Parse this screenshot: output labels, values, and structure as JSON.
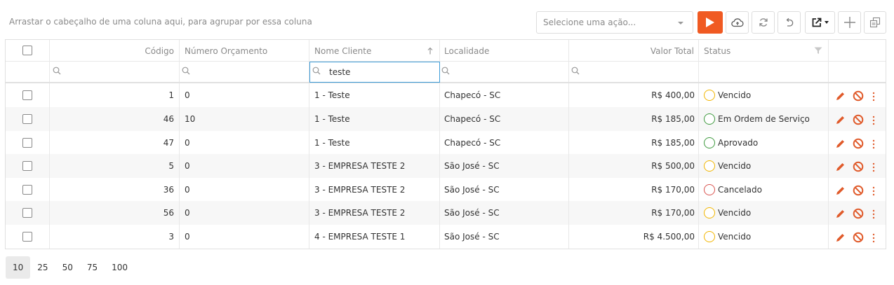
{
  "toolbar": {
    "group_panel_text": "Arrastar o cabeçalho de uma coluna aqui, para agrupar por essa coluna",
    "action_select_placeholder": "Selecione uma ação...",
    "buttons": [
      "play-icon",
      "cloud-upload-icon",
      "refresh-icon",
      "undo-icon",
      "export-icon",
      "plus-icon",
      "column-chooser-icon"
    ],
    "accent_color": "#f05a22"
  },
  "grid": {
    "columns": {
      "codigo": "Código",
      "numero_orcamento": "Número Orçamento",
      "nome_cliente": "Nome Cliente",
      "localidade": "Localidade",
      "valor_total": "Valor Total",
      "status": "Status"
    },
    "filters": {
      "nome_cliente": "teste"
    },
    "rows": [
      {
        "codigo": "1",
        "numero_orcamento": "0",
        "nome_cliente": "1 - Teste",
        "localidade": "Chapecó - SC",
        "valor_total": "R$ 400,00",
        "status": "Vencido",
        "status_color": "#f2b600"
      },
      {
        "codigo": "46",
        "numero_orcamento": "10",
        "nome_cliente": "1 - Teste",
        "localidade": "Chapecó - SC",
        "valor_total": "R$ 185,00",
        "status": "Em Ordem de Serviço",
        "status_color": "#3f9a3f"
      },
      {
        "codigo": "47",
        "numero_orcamento": "0",
        "nome_cliente": "1 - Teste",
        "localidade": "Chapecó - SC",
        "valor_total": "R$ 185,00",
        "status": "Aprovado",
        "status_color": "#3f9a3f"
      },
      {
        "codigo": "5",
        "numero_orcamento": "0",
        "nome_cliente": "3 - EMPRESA TESTE 2",
        "localidade": "São José - SC",
        "valor_total": "R$ 500,00",
        "status": "Vencido",
        "status_color": "#f2b600"
      },
      {
        "codigo": "36",
        "numero_orcamento": "0",
        "nome_cliente": "3 - EMPRESA TESTE 2",
        "localidade": "São José - SC",
        "valor_total": "R$ 170,00",
        "status": "Cancelado",
        "status_color": "#d9534f"
      },
      {
        "codigo": "56",
        "numero_orcamento": "0",
        "nome_cliente": "3 - EMPRESA TESTE 2",
        "localidade": "São José - SC",
        "valor_total": "R$ 170,00",
        "status": "Vencido",
        "status_color": "#f2b600"
      },
      {
        "codigo": "3",
        "numero_orcamento": "0",
        "nome_cliente": "4 - EMPRESA TESTE 1",
        "localidade": "São José - SC",
        "valor_total": "R$ 4.500,00",
        "status": "Vencido",
        "status_color": "#f2b600"
      }
    ],
    "row_action_icons": [
      "pencil-icon",
      "ban-icon",
      "more-vertical-icon"
    ],
    "action_color": "#e05a2a"
  },
  "pager": {
    "page_sizes": [
      "10",
      "25",
      "50",
      "75",
      "100"
    ],
    "selected_page_size": "10"
  }
}
